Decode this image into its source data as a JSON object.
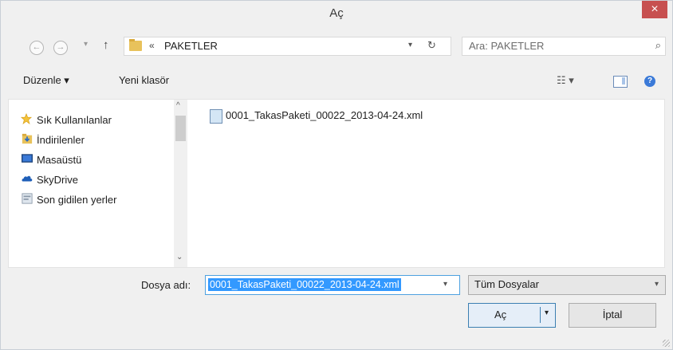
{
  "window": {
    "title": "Aç",
    "close_glyph": "×"
  },
  "nav": {
    "back_glyph": "←",
    "forward_glyph": "→",
    "recent_glyph": "▾",
    "up_glyph": "↑",
    "breadcrumb_chevron": "«",
    "path": "PAKETLER",
    "address_dropdown_glyph": "▾",
    "refresh_glyph": "↻",
    "search_placeholder": "Ara: PAKETLER",
    "search_glyph": "⌕"
  },
  "toolbar": {
    "organize_label": "Düzenle ▾",
    "new_folder_label": "Yeni klasör",
    "view_glyph": "☷ ▾",
    "help_glyph": "?"
  },
  "sidebar": {
    "items": [
      {
        "label": "Sık Kullanılanlar",
        "icon": "star-icon"
      },
      {
        "label": "İndirilenler",
        "icon": "downloads-icon"
      },
      {
        "label": "Masaüstü",
        "icon": "desktop-icon"
      },
      {
        "label": "SkyDrive",
        "icon": "skydrive-icon"
      },
      {
        "label": "Son gidilen yerler",
        "icon": "recent-places-icon"
      }
    ],
    "scroll_up_glyph": "^",
    "scroll_down_glyph": "⌄"
  },
  "files": [
    {
      "name": "0001_TakasPaketi_00022_2013-04-24.xml",
      "icon": "xml-file-icon"
    }
  ],
  "bottom": {
    "filename_label": "Dosya adı:",
    "filename_value": "0001_TakasPaketi_00022_2013-04-24.xml",
    "filename_dropdown_glyph": "▾",
    "filter_value": "Tüm Dosyalar",
    "filter_dropdown_glyph": "▾",
    "open_label": "Aç",
    "open_dropdown_glyph": "▾",
    "cancel_label": "İptal"
  },
  "colors": {
    "selection": "#3399ff",
    "close_button": "#c75050",
    "focus_border": "#4ea1e0"
  }
}
